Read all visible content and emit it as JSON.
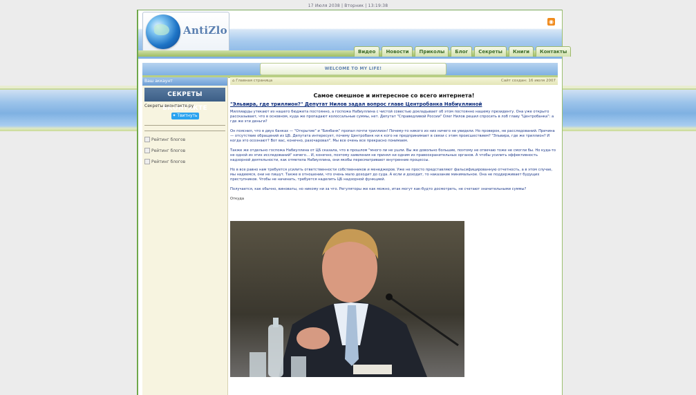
{
  "topbar": {
    "text": "17 Июля 2038 | Вторник | 13:19:38"
  },
  "logo": {
    "text": "AntiZlo"
  },
  "icons": {
    "rss": "rss-icon",
    "twitter": "twitter-icon",
    "globe": "globe-icon"
  },
  "nav": {
    "items": [
      "Видео",
      "Новости",
      "Приколы",
      "Блог",
      "Секреты",
      "Книги",
      "Контакты"
    ]
  },
  "welcome": {
    "text": "WELCOME TO MY LIFE!"
  },
  "sidebar": {
    "header": "Ваш аккаунт",
    "vk_banner": "СЕКРЕТЫ ВКОНТАКТЕ",
    "vk_link": "Секреты вконтакте.ру",
    "tweet_label": "Твитнуть",
    "ratings": [
      "Рейтинг блогов",
      "Рейтинг блогов",
      "Рейтинг блогов"
    ]
  },
  "main": {
    "breadcrumb": "Главная страница",
    "site_date": "Сайт создан: 16 июля 2007",
    "site_title": "Самое смешное и интересное со всего интернета!",
    "article_title": "\"Эльвира, где триллион?\" Депутат Нилов задал вопрос главе Центробанка Набиуллиной",
    "paragraphs": [
      "Миллиарды утекают из нашего бюджета постоянно, а госпожа Набиуллина с чистой совестью докладывает об этом постоянно нашему президенту. Она уже открыто рассказывает, что в основном, куда же пропадают колоссальные суммы, нет. Депутат \"Справедливой России\" Олег Нилов решил спросить в лоб главу \"Центробанка\": а где же эти деньги?",
      "Он пояснил, что в двух банках — \"Открытие\" и \"Бинбанк\" пропал почти триллион! Почему-то никого из них ничего не увидели. Но проверок, не расследований. Причина — отсутствие обращений из ЦБ. Депутата интересует, почему Центробанк ни к кого не предпринимает в связи с этим происшествием? \"Эльвира, где же триллион? И когда это осознают? Вот вас, конечно, разочаровал\". Мы все очень все прекрасно понимаем.",
      "Также же отдельно госпожа Набиуллина от ЦБ сказала, что в прошлом \"много ли не ушли. Вы же довольно большие, поэтому не отвечаю тоже не смогли бы. Но куда-то не одной из этих исследований\" ничего… И, конечно, поэтому заявления не принял ни одним из правоохранительных органов. А чтобы усилить эффективность надзорной деятельности, как отметила Набиуллина, они якобы пересматривают внутренние процессы.",
      "Но в все равно нам требуется усилить ответственности собственников и менеджеров. Уже не просто представляют фальсифицированную отчетность, а в этом случае, мы надеемся, они не пишут. Также в отношении, что очень мало доходит до суда. А если и доходит, то наказание минимальное. Она не поддерживает будущих преступников. Чтобы не начинать, требуется наделить ЦБ надзорной функцией.",
      "Получается, как обычно, виноваты, но никому ни за что. Регуляторы же как можно, итак могут как-будто досмотреть, не счетают значительными суммы?"
    ],
    "source": "Откуда",
    "photo_alt": "Фото: депутат Олег Нилов"
  },
  "colors": {
    "accent_blue": "#7fb1e2",
    "accent_green": "#9fbd63",
    "link": "#0a2a7a"
  }
}
